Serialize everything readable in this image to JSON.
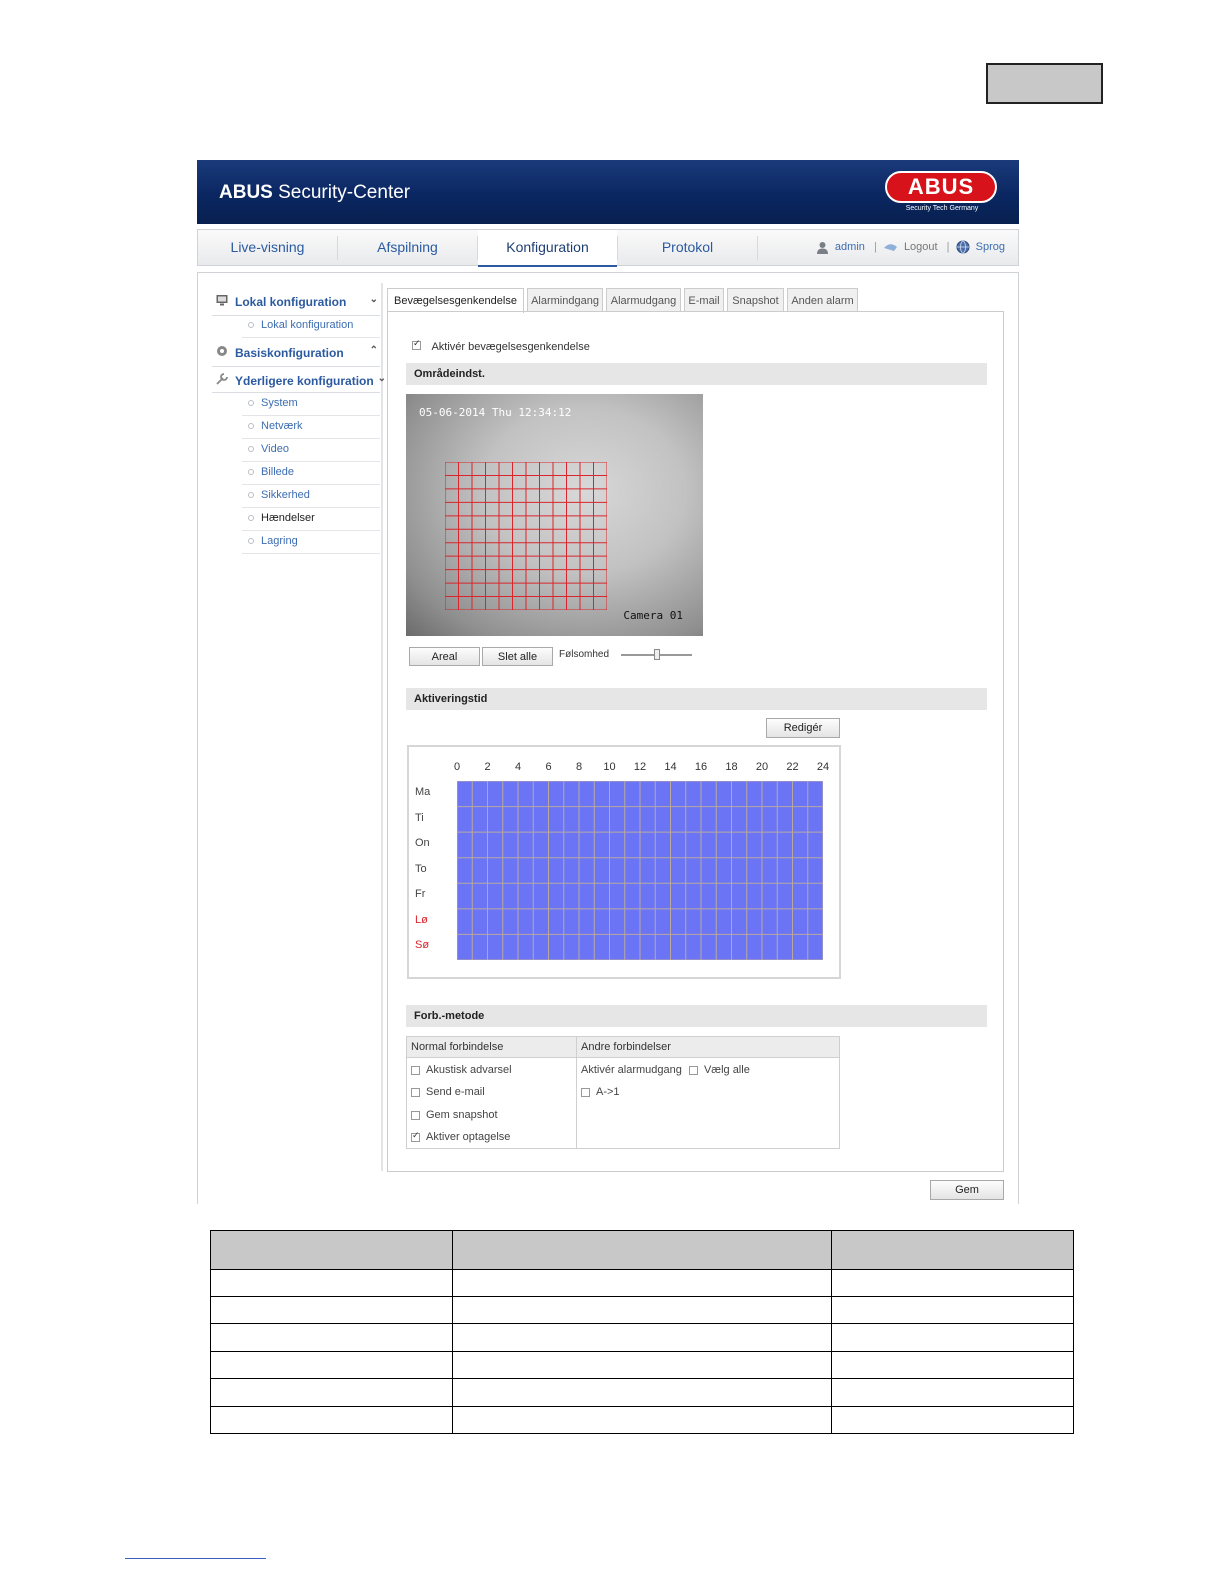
{
  "header": {
    "app_title_bold": "ABUS",
    "app_title_rest": " Security-Center",
    "logo_text": "ABUS",
    "logo_subtitle": "Security Tech Germany"
  },
  "nav": {
    "tabs": [
      "Live-visning",
      "Afspilning",
      "Konfiguration",
      "Protokol"
    ],
    "active": "Konfiguration",
    "user": "admin",
    "logout": "Logout",
    "language": "Sprog"
  },
  "sidebar": {
    "sections": [
      {
        "label": "Lokal konfiguration",
        "chevron": "⌄",
        "items": [
          "Lokal konfiguration"
        ]
      },
      {
        "label": "Basiskonfiguration",
        "chevron": "⌃",
        "items": []
      },
      {
        "label": "Yderligere konfiguration",
        "chevron": "⌄",
        "items": [
          "System",
          "Netværk",
          "Video",
          "Billede",
          "Sikkerhed",
          "Hændelser",
          "Lagring"
        ]
      }
    ],
    "active_item": "Hændelser"
  },
  "content_tabs": [
    "Bevægelsesgenkendelse",
    "Alarmindgang",
    "Alarmudgang",
    "E-mail",
    "Snapshot",
    "Anden alarm"
  ],
  "motion": {
    "enable_label": "Aktivér bevægelsesgenkendelse",
    "enabled": true,
    "area_section": "Områdeindst.",
    "camera_timestamp": "05-06-2014 Thu 12:34:12",
    "camera_name": "Camera 01",
    "btn_area": "Areal",
    "btn_delete_all": "Slet alle",
    "sensitivity_label": "Følsomhed",
    "sensitivity_value": 0.5
  },
  "schedule": {
    "section": "Aktiveringstid",
    "edit_button": "Redigér",
    "hours": [
      "0",
      "2",
      "4",
      "6",
      "8",
      "10",
      "12",
      "14",
      "16",
      "18",
      "20",
      "22",
      "24"
    ],
    "days": [
      "Ma",
      "Ti",
      "On",
      "To",
      "Fr",
      "Lø",
      "Sø"
    ],
    "fill_color": "#6b74f4"
  },
  "linkage": {
    "section": "Forb.-metode",
    "normal_header": "Normal forbindelse",
    "other_header": "Andre forbindelser",
    "normal_options": [
      {
        "label": "Akustisk advarsel",
        "checked": false
      },
      {
        "label": "Send e-mail",
        "checked": false
      },
      {
        "label": "Gem snapshot",
        "checked": false
      },
      {
        "label": "Aktiver optagelse",
        "checked": true
      }
    ],
    "alarm_output_label": "Aktivér alarmudgang",
    "select_all_label": "Vælg alle",
    "alarm_output_item": "A->1"
  },
  "save_button": "Gem",
  "colors": {
    "banner": "#0b2762",
    "nav_text": "#2b5aa0",
    "motion_grid": "#d9252b",
    "weekend": "#d9252b"
  }
}
